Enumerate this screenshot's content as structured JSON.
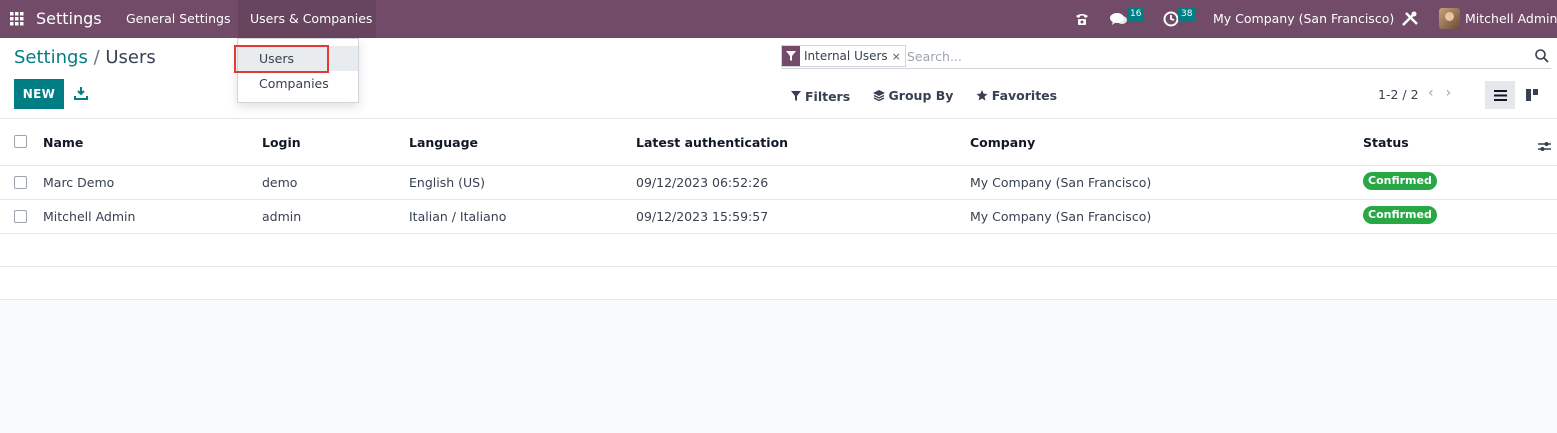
{
  "topbar": {
    "brand": "Settings",
    "menu_general": "General Settings",
    "menu_users_companies": "Users & Companies",
    "chat_badge": "16",
    "activity_badge": "38",
    "company": "My Company (San Francisco)",
    "user": "Mitchell Admin"
  },
  "dropdown": {
    "users": "Users",
    "companies": "Companies"
  },
  "breadcrumb": {
    "parent": "Settings",
    "separator": "/",
    "current": "Users"
  },
  "actions": {
    "new_label": "NEW"
  },
  "search": {
    "facet_label": "Internal Users",
    "facet_remove": "×",
    "placeholder": "Search..."
  },
  "filters": {
    "filters_label": "Filters",
    "group_by_label": "Group By",
    "favorites_label": "Favorites"
  },
  "pager": {
    "range": "1-2 / 2",
    "prev": "‹",
    "next": "›"
  },
  "table": {
    "headers": [
      "Name",
      "Login",
      "Language",
      "Latest authentication",
      "Company",
      "Status"
    ],
    "rows": [
      {
        "name": "Marc Demo",
        "login": "demo",
        "language": "English (US)",
        "auth": "09/12/2023 06:52:26",
        "company": "My Company (San Francisco)",
        "status": "Confirmed"
      },
      {
        "name": "Mitchell Admin",
        "login": "admin",
        "language": "Italian / Italiano",
        "auth": "09/12/2023 15:59:57",
        "company": "My Company (San Francisco)",
        "status": "Confirmed"
      }
    ]
  },
  "colors": {
    "topbar": "#714b67",
    "primary": "#017e84",
    "status_confirmed": "#28a745",
    "highlight": "#e03b35"
  },
  "icons": [
    "apps-grid-icon",
    "phone-icon",
    "chat-icon",
    "clock-icon",
    "tools-icon",
    "download-icon",
    "filter-icon",
    "search-icon",
    "layers-icon",
    "star-icon",
    "list-view-icon",
    "kanban-view-icon",
    "column-settings-icon"
  ]
}
